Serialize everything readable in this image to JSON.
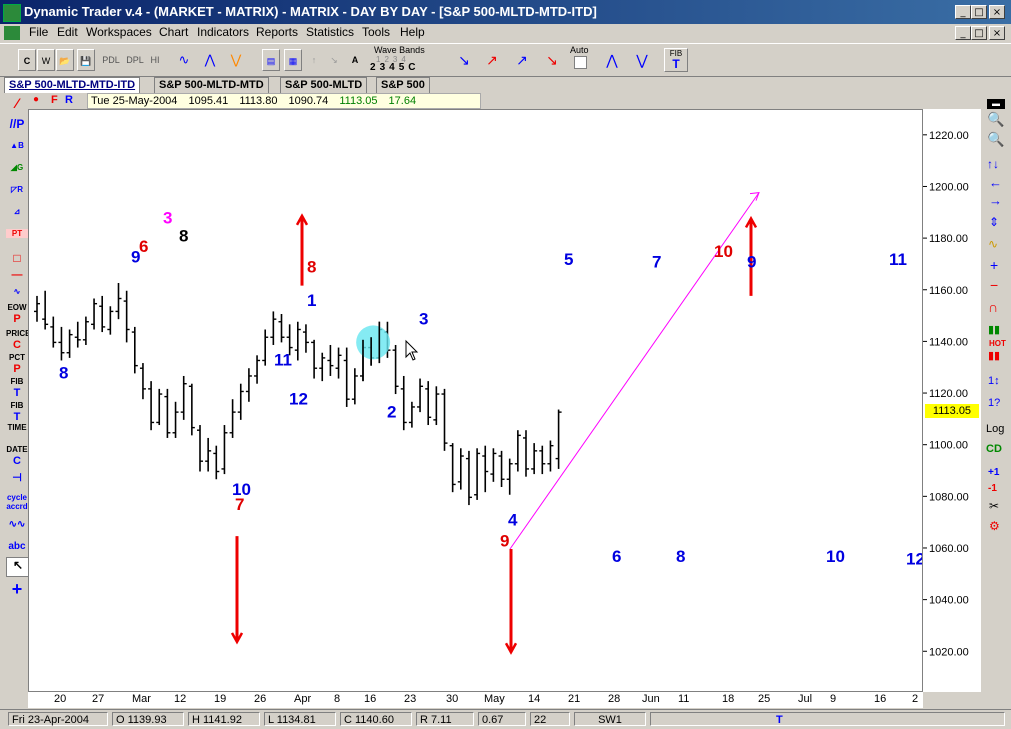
{
  "window": {
    "title": "Dynamic Trader v.4 - (MARKET - MATRIX) - MATRIX - DAY BY DAY - [S&P 500-MLTD-MTD-ITD]",
    "controls": [
      "_",
      "□",
      "×"
    ],
    "inner_controls": [
      "_",
      "□",
      "×"
    ]
  },
  "menu": [
    "File",
    "Edit",
    "Workspaces",
    "Chart",
    "Indicators",
    "Reports",
    "Statistics",
    "Tools",
    "Help"
  ],
  "toolbar": {
    "buttons_left": [
      "C",
      "W",
      "📂",
      "💾",
      "PDL",
      "DPL",
      "HI"
    ],
    "wave_bands_label": "Wave Bands",
    "wave_row1": [
      "1",
      "2",
      "3",
      "4"
    ],
    "wave_row2": [
      "2",
      "3",
      "4",
      "5",
      "C"
    ],
    "wave_a": "A",
    "auto_label": "Auto",
    "fib_label": "FIB",
    "fib_t": "T"
  },
  "tabs": [
    "S&P 500-MLTD-MTD-ITD",
    "S&P 500-MLTD-MTD",
    "S&P 500-MLTD",
    "S&P 500"
  ],
  "infobar": {
    "flags": [
      "F",
      "R"
    ],
    "date": "Tue 25-May-2004",
    "open": "1095.41",
    "high": "1113.80",
    "low": "1090.74",
    "close": "1113.05",
    "change": "17.64"
  },
  "left_tools": [
    "P",
    "B",
    "G",
    "R",
    "PT",
    "EOW",
    "P",
    "PRICE",
    "C",
    "PCT",
    "P",
    "FIB",
    "T",
    "FIB",
    "T",
    "TIME",
    "DATE",
    "C",
    "cycle",
    "accrd",
    "abc"
  ],
  "right_tools": [
    "Log",
    "CD",
    "+1",
    "-1",
    "HOT"
  ],
  "chart_data": {
    "type": "ohlc-bar",
    "y_ticks": [
      "1220.00",
      "1200.00",
      "1180.00",
      "1160.00",
      "1140.00",
      "1120.00",
      "1100.00",
      "1080.00",
      "1060.00",
      "1040.00",
      "1020.00"
    ],
    "ylim": [
      1005,
      1230
    ],
    "current_price": "1113.05",
    "x_ticks": [
      "20",
      "27",
      "Mar",
      "12",
      "19",
      "26",
      "Apr",
      "8",
      "16",
      "23",
      "30",
      "May",
      "14",
      "21",
      "28",
      "Jun",
      "11",
      "18",
      "25",
      "Jul",
      "9",
      "16",
      "2"
    ],
    "bars": [
      [
        1152,
        1158,
        1148,
        1155
      ],
      [
        1149,
        1160,
        1145,
        1147
      ],
      [
        1146,
        1150,
        1138,
        1140
      ],
      [
        1140,
        1146,
        1133,
        1136
      ],
      [
        1136,
        1145,
        1134,
        1143
      ],
      [
        1142,
        1148,
        1138,
        1141
      ],
      [
        1141,
        1150,
        1139,
        1148
      ],
      [
        1147,
        1157,
        1145,
        1155
      ],
      [
        1154,
        1158,
        1144,
        1146
      ],
      [
        1145,
        1154,
        1143,
        1152
      ],
      [
        1152,
        1163,
        1149,
        1157
      ],
      [
        1156,
        1160,
        1140,
        1145
      ],
      [
        1144,
        1146,
        1128,
        1131
      ],
      [
        1130,
        1132,
        1118,
        1122
      ],
      [
        1122,
        1125,
        1106,
        1109
      ],
      [
        1109,
        1122,
        1108,
        1120
      ],
      [
        1119,
        1122,
        1103,
        1105
      ],
      [
        1105,
        1117,
        1103,
        1113
      ],
      [
        1113,
        1127,
        1110,
        1124
      ],
      [
        1123,
        1124,
        1104,
        1107
      ],
      [
        1106,
        1108,
        1090,
        1094
      ],
      [
        1094,
        1103,
        1090,
        1098
      ],
      [
        1097,
        1100,
        1087,
        1090
      ],
      [
        1091,
        1108,
        1089,
        1105
      ],
      [
        1105,
        1118,
        1103,
        1113
      ],
      [
        1113,
        1124,
        1110,
        1121
      ],
      [
        1121,
        1130,
        1117,
        1127
      ],
      [
        1127,
        1135,
        1124,
        1133
      ],
      [
        1133,
        1145,
        1131,
        1142
      ],
      [
        1142,
        1152,
        1139,
        1149
      ],
      [
        1148,
        1151,
        1140,
        1142
      ],
      [
        1142,
        1147,
        1135,
        1138
      ],
      [
        1137,
        1148,
        1133,
        1145
      ],
      [
        1144,
        1147,
        1136,
        1140
      ],
      [
        1140,
        1141,
        1126,
        1130
      ],
      [
        1130,
        1136,
        1125,
        1134
      ],
      [
        1133,
        1139,
        1127,
        1131
      ],
      [
        1130,
        1138,
        1126,
        1135
      ],
      [
        1133,
        1138,
        1115,
        1118
      ],
      [
        1118,
        1130,
        1116,
        1127
      ],
      [
        1127,
        1141,
        1125,
        1138
      ],
      [
        1138,
        1142,
        1131,
        1134
      ],
      [
        1134,
        1148,
        1132,
        1145
      ],
      [
        1144,
        1148,
        1134,
        1137
      ],
      [
        1137,
        1139,
        1120,
        1123
      ],
      [
        1122,
        1127,
        1106,
        1109
      ],
      [
        1109,
        1117,
        1107,
        1115
      ],
      [
        1115,
        1126,
        1113,
        1123
      ],
      [
        1122,
        1125,
        1108,
        1111
      ],
      [
        1110,
        1123,
        1108,
        1120
      ],
      [
        1120,
        1122,
        1098,
        1101
      ],
      [
        1100,
        1101,
        1082,
        1085
      ],
      [
        1086,
        1099,
        1083,
        1096
      ],
      [
        1095,
        1098,
        1077,
        1080
      ],
      [
        1081,
        1099,
        1079,
        1097
      ],
      [
        1096,
        1100,
        1082,
        1090
      ],
      [
        1089,
        1099,
        1086,
        1097
      ],
      [
        1096,
        1098,
        1084,
        1087
      ],
      [
        1087,
        1095,
        1081,
        1093
      ],
      [
        1093,
        1106,
        1090,
        1104
      ],
      [
        1103,
        1106,
        1088,
        1091
      ],
      [
        1091,
        1101,
        1089,
        1098
      ],
      [
        1098,
        1100,
        1089,
        1093
      ],
      [
        1093,
        1102,
        1090,
        1100
      ],
      [
        1095,
        1114,
        1091,
        1113
      ]
    ],
    "labels": [
      {
        "text": "3",
        "color": "#ff00ff",
        "x": 134,
        "y": 1186
      },
      {
        "text": "8",
        "color": "#000000",
        "x": 150,
        "y": 1179
      },
      {
        "text": "6",
        "color": "#e00000",
        "x": 110,
        "y": 1175
      },
      {
        "text": "9",
        "color": "#0000e0",
        "x": 102,
        "y": 1171
      },
      {
        "text": "8",
        "color": "#0000e0",
        "x": 30,
        "y": 1126
      },
      {
        "text": "10",
        "color": "#0000e0",
        "x": 203,
        "y": 1081
      },
      {
        "text": "7",
        "color": "#e00000",
        "x": 206,
        "y": 1075
      },
      {
        "text": "11",
        "color": "#0000e0",
        "x": 245,
        "y": 1131
      },
      {
        "text": "12",
        "color": "#0000e0",
        "x": 260,
        "y": 1116
      },
      {
        "text": "8",
        "color": "#e00000",
        "x": 278,
        "y": 1167
      },
      {
        "text": "1",
        "color": "#0000e0",
        "x": 278,
        "y": 1154
      },
      {
        "text": "3",
        "color": "#0000e0",
        "x": 390,
        "y": 1147
      },
      {
        "text": "2",
        "color": "#0000e0",
        "x": 358,
        "y": 1111
      },
      {
        "text": "4",
        "color": "#0000e0",
        "x": 479,
        "y": 1069
      },
      {
        "text": "9",
        "color": "#e00000",
        "x": 471,
        "y": 1061
      },
      {
        "text": "5",
        "color": "#0000e0",
        "x": 535,
        "y": 1170
      },
      {
        "text": "7",
        "color": "#0000e0",
        "x": 623,
        "y": 1169
      },
      {
        "text": "10",
        "color": "#e00000",
        "x": 685,
        "y": 1173
      },
      {
        "text": "9",
        "color": "#0000e0",
        "x": 718,
        "y": 1169
      },
      {
        "text": "11",
        "color": "#0000e0",
        "x": 860,
        "y": 1170
      },
      {
        "text": "6",
        "color": "#0000e0",
        "x": 583,
        "y": 1055
      },
      {
        "text": "8",
        "color": "#0000e0",
        "x": 647,
        "y": 1055
      },
      {
        "text": "10",
        "color": "#0000e0",
        "x": 797,
        "y": 1055
      },
      {
        "text": "12",
        "color": "#0000e0",
        "x": 877,
        "y": 1054
      }
    ],
    "arrows": [
      {
        "dir": "down",
        "x": 208,
        "y_from": 1065,
        "y_to": 1024
      },
      {
        "dir": "up",
        "x": 273,
        "y_from": 1162,
        "y_to": 1189
      },
      {
        "dir": "down",
        "x": 482,
        "y_from": 1060,
        "y_to": 1020
      },
      {
        "dir": "up",
        "x": 722,
        "y_from": 1158,
        "y_to": 1188
      }
    ],
    "trendline": {
      "color": "#ff00ff",
      "from": [
        481,
        1060
      ],
      "to": [
        730,
        1198
      ]
    }
  },
  "status": {
    "date": "Fri 23-Apr-2004",
    "open": "O 1139.93",
    "high": "H 1141.92",
    "low": "L 1134.81",
    "close": "C 1140.60",
    "range": "R 7.11",
    "val": "0.67",
    "num": "22",
    "sw": "SW1",
    "t": "T"
  }
}
